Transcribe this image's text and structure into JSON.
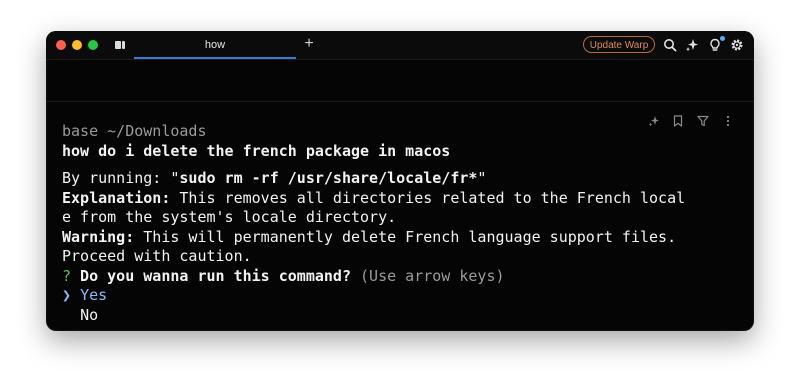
{
  "tab": {
    "title": "how"
  },
  "header": {
    "update_label": "Update Warp"
  },
  "terminal": {
    "cwd_line": "base ~/Downloads",
    "command": "how do i delete the french package in macos",
    "running_prefix": "By running: \"",
    "running_cmd": "sudo rm -rf /usr/share/locale/fr*",
    "running_suffix": "\"",
    "explanation_label": "Explanation:",
    "explanation_text_1": " This removes all directories related to the French local",
    "explanation_text_2": "e from the system's locale directory.",
    "warning_label": "Warning:",
    "warning_text_1": " This will permanently delete French language support files.",
    "warning_text_2": "Proceed with caution.",
    "question_mark": "?",
    "question": " Do you wanna run this command?",
    "question_hint": " (Use arrow keys)",
    "selector": "❯",
    "option_yes": "Yes",
    "option_no": "No"
  },
  "icons": {
    "toolbar": [
      "tabs-icon",
      "new-tab-icon",
      "search-icon",
      "ai-sparkle-icon",
      "lightbulb-icon",
      "settings-gear-icon"
    ],
    "block": [
      "ai-sparkle-icon",
      "bookmark-icon",
      "filter-icon",
      "more-vertical-icon"
    ]
  },
  "colors": {
    "window_bg": "#050505",
    "tab_underline": "#3d7ad6",
    "update_border": "#b86a39",
    "prompt_green": "#5fc063",
    "selected_blue": "#8ab9ff"
  }
}
